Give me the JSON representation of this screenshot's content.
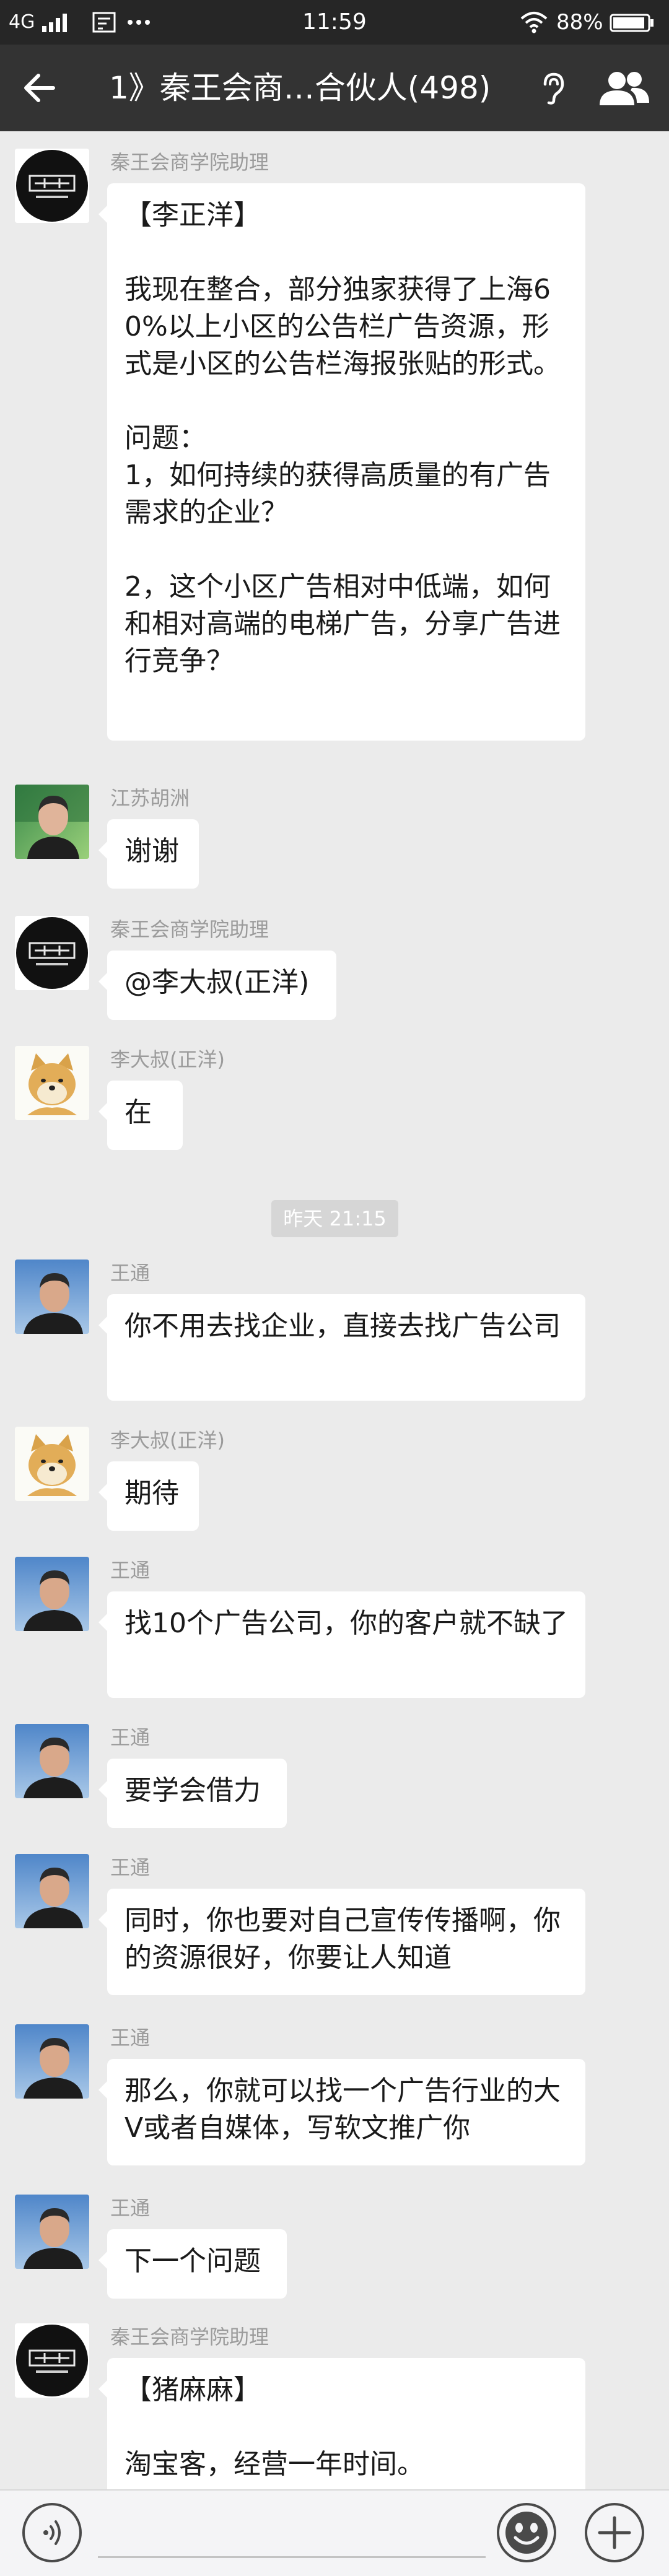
{
  "status_bar": {
    "network": "4G",
    "time": "11:59",
    "battery": "88%"
  },
  "header": {
    "title": "1》秦王会商…合伙人(498)",
    "back_icon": "arrow-left-icon",
    "listen_icon": "ear-icon",
    "members_icon": "group-icon"
  },
  "time_divider": "昨天 21:15",
  "messages": [
    {
      "sender": "秦王会商学院助理",
      "avatar": "qinwanghui-logo",
      "text": "【李正洋】\n\n我现在整合，部分独家获得了上海60%以上小区的公告栏广告资源，形式是小区的公告栏海报张贴的形式。\n\n问题：\n1，如何持续的获得高质量的有广告需求的企业？\n\n2，这个小区广告相对中低端，如何和相对高端的电梯广告，分享广告进行竞争？"
    },
    {
      "sender": "江苏胡洲",
      "avatar": "photo-man",
      "text": "谢谢"
    },
    {
      "sender": "秦王会商学院助理",
      "avatar": "qinwanghui-logo",
      "text": "@李大叔(正洋)"
    },
    {
      "sender": "李大叔(正洋)",
      "avatar": "shiba-dog",
      "text": "在"
    },
    {
      "sender": "王通",
      "avatar": "photo-wangtong",
      "text": "你不用去找企业，直接去找广告公司"
    },
    {
      "sender": "李大叔(正洋)",
      "avatar": "shiba-dog",
      "text": "期待"
    },
    {
      "sender": "王通",
      "avatar": "photo-wangtong",
      "text": "找10个广告公司，你的客户就不缺了"
    },
    {
      "sender": "王通",
      "avatar": "photo-wangtong",
      "text": "要学会借力"
    },
    {
      "sender": "王通",
      "avatar": "photo-wangtong",
      "text": "同时，你也要对自己宣传传播啊，你的资源很好，你要让人知道"
    },
    {
      "sender": "王通",
      "avatar": "photo-wangtong",
      "text": "那么，你就可以找一个广告行业的大V或者自媒体，写软文推广你"
    },
    {
      "sender": "王通",
      "avatar": "photo-wangtong",
      "text": "下一个问题"
    },
    {
      "sender": "秦王会商学院助理",
      "avatar": "qinwanghui-logo",
      "text": "【猪麻麻】\n\n淘宝客，经营一年时间。"
    }
  ],
  "input_bar": {
    "voice_icon": "voice-icon",
    "emoji_icon": "emoji-icon",
    "plus_icon": "plus-icon"
  },
  "colors": {
    "header_bg": "#333333",
    "status_bg": "#262626",
    "chat_bg": "#ebebeb",
    "bubble_bg": "#ffffff",
    "sender_text": "#9b9b9b"
  }
}
